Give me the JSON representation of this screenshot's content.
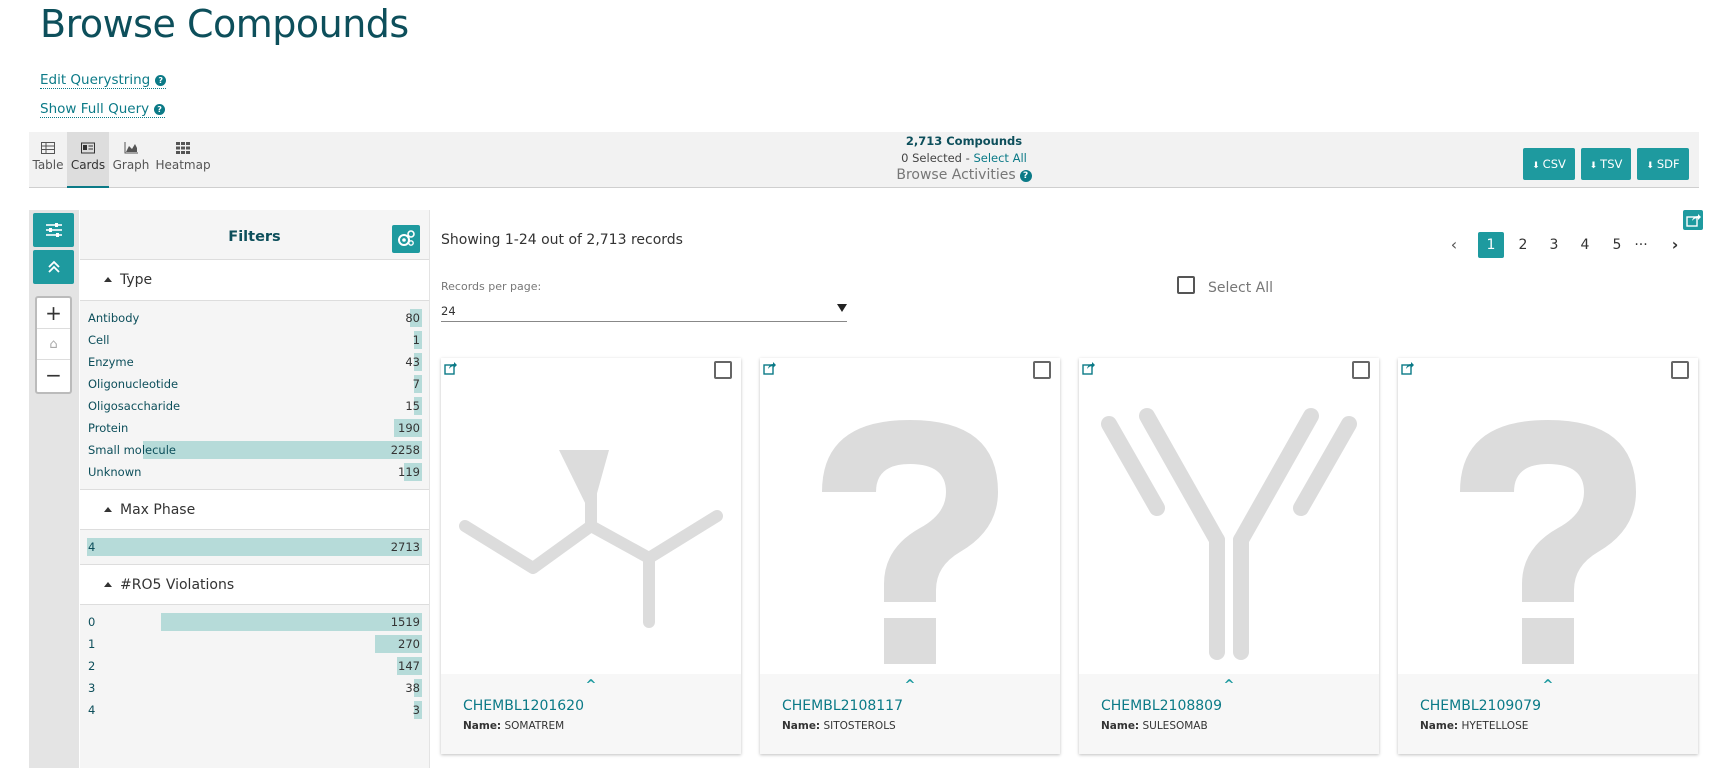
{
  "page": {
    "title": "Browse Compounds"
  },
  "links": {
    "edit_querystring": "Edit Querystring",
    "show_full_query": "Show Full Query"
  },
  "view_tabs": [
    {
      "label": "Table",
      "icon": "table-icon"
    },
    {
      "label": "Cards",
      "icon": "cards-icon",
      "active": true
    },
    {
      "label": "Graph",
      "icon": "graph-icon"
    },
    {
      "label": "Heatmap",
      "icon": "heatmap-icon"
    }
  ],
  "summary": {
    "count": "2,713 Compounds",
    "selected": "0 Selected - ",
    "select_all": "Select All",
    "browse_activities": "Browse Activities"
  },
  "downloads": [
    {
      "label": "CSV",
      "icon": "download-icon"
    },
    {
      "label": "TSV",
      "icon": "download-icon"
    },
    {
      "label": "SDF",
      "icon": "download-icon"
    }
  ],
  "filters": {
    "title": "Filters",
    "facets": [
      {
        "name": "Type",
        "items": [
          {
            "label": "Antibody",
            "count": "80",
            "fraction": 0.035
          },
          {
            "label": "Cell",
            "count": "1",
            "fraction": 0.0
          },
          {
            "label": "Enzyme",
            "count": "43",
            "fraction": 0.019
          },
          {
            "label": "Oligonucleotide",
            "count": "7",
            "fraction": 0.003
          },
          {
            "label": "Oligosaccharide",
            "count": "15",
            "fraction": 0.007
          },
          {
            "label": "Protein",
            "count": "190",
            "fraction": 0.084
          },
          {
            "label": "Small molecule",
            "count": "2258",
            "fraction": 0.832
          },
          {
            "label": "Unknown",
            "count": "119",
            "fraction": 0.053
          }
        ]
      },
      {
        "name": "Max Phase",
        "items": [
          {
            "label": "4",
            "count": "2713",
            "fraction": 1.0
          }
        ]
      },
      {
        "name": "#RO5 Violations",
        "items": [
          {
            "label": "0",
            "count": "1519",
            "fraction": 0.78
          },
          {
            "label": "1",
            "count": "270",
            "fraction": 0.139
          },
          {
            "label": "2",
            "count": "147",
            "fraction": 0.075
          },
          {
            "label": "3",
            "count": "38",
            "fraction": 0.02
          },
          {
            "label": "4",
            "count": "3",
            "fraction": 0.002
          }
        ]
      }
    ]
  },
  "results": {
    "showing": "Showing 1-24 out of 2,713 records",
    "records_per_page_label": "Records per page:",
    "records_per_page": "24",
    "select_all": "Select All",
    "pages": [
      "1",
      "2",
      "3",
      "4",
      "5",
      "···"
    ],
    "current_page": "1"
  },
  "cards": [
    {
      "id": "CHEMBL1201620",
      "name_label": "Name:",
      "name": "SOMATREM",
      "image": "protein-structure-icon"
    },
    {
      "id": "CHEMBL2108117",
      "name_label": "Name:",
      "name": "SITOSTEROLS",
      "image": "question-mark-icon"
    },
    {
      "id": "CHEMBL2108809",
      "name_label": "Name:",
      "name": "SULESOMAB",
      "image": "antibody-structure-icon"
    },
    {
      "id": "CHEMBL2109079",
      "name_label": "Name:",
      "name": "HYETELLOSE",
      "image": "question-mark-icon"
    }
  ],
  "colors": {
    "accent": "#1e9a9f",
    "title": "#0d4f5b",
    "link": "#0b7a87",
    "bar": "#b6dbd9"
  }
}
